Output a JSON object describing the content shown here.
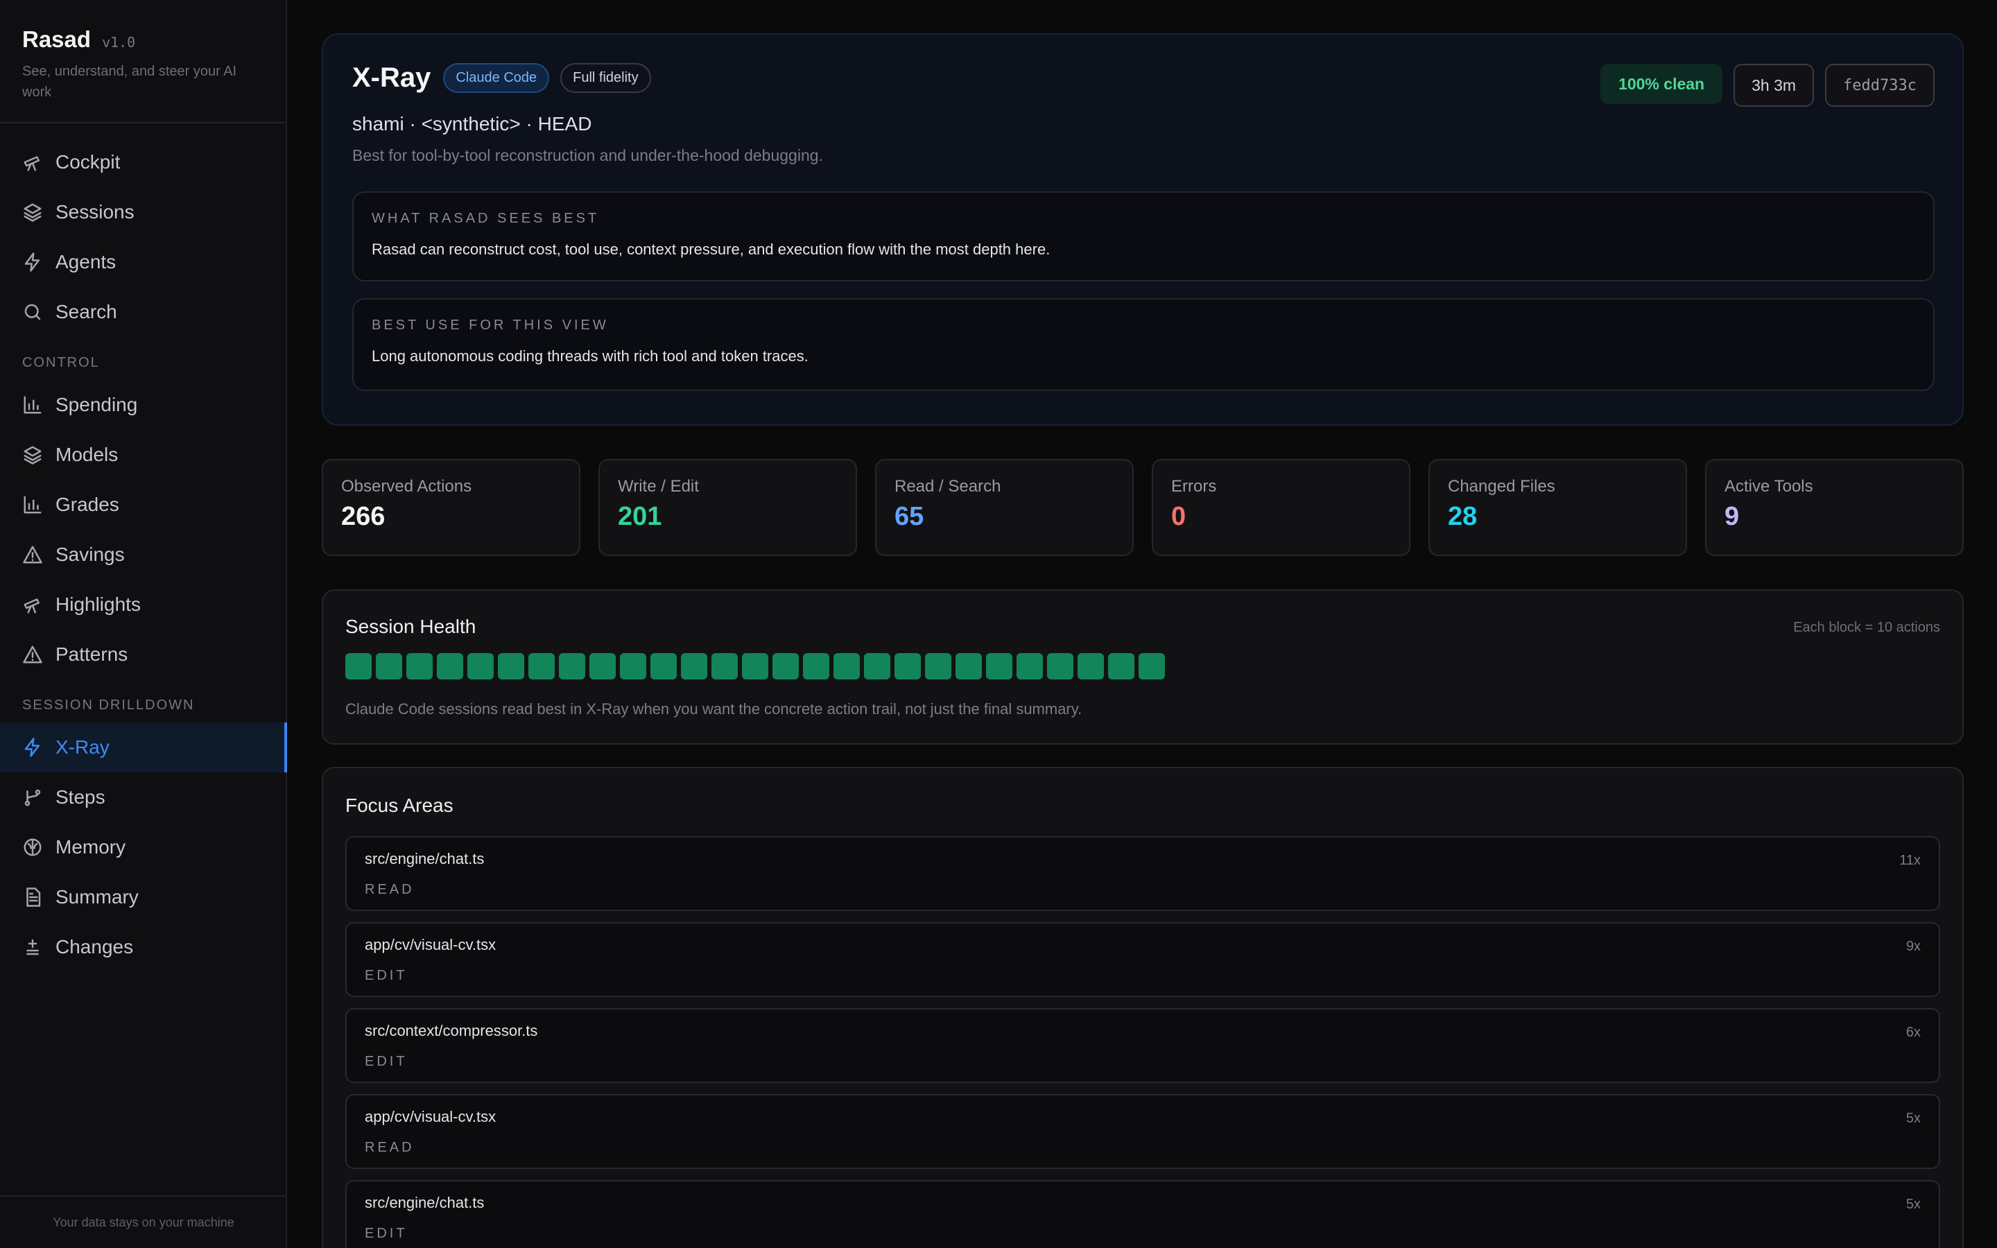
{
  "app": {
    "name": "Rasad",
    "version": "v1.0",
    "tagline": "See, understand, and steer your AI work",
    "footer": "Your data stays on your machine"
  },
  "nav": {
    "main": [
      {
        "label": "Cockpit",
        "icon": "telescope-icon"
      },
      {
        "label": "Sessions",
        "icon": "layers-icon"
      },
      {
        "label": "Agents",
        "icon": "bolt-icon"
      },
      {
        "label": "Search",
        "icon": "search-icon"
      }
    ],
    "control_label": "CONTROL",
    "control": [
      {
        "label": "Spending",
        "icon": "bar-chart-icon"
      },
      {
        "label": "Models",
        "icon": "layers-icon"
      },
      {
        "label": "Grades",
        "icon": "bar-chart-icon"
      },
      {
        "label": "Savings",
        "icon": "warning-icon"
      },
      {
        "label": "Highlights",
        "icon": "telescope-icon"
      },
      {
        "label": "Patterns",
        "icon": "warning-icon"
      }
    ],
    "drilldown_label": "SESSION DRILLDOWN",
    "drilldown": [
      {
        "label": "X-Ray",
        "icon": "bolt-icon",
        "active": true
      },
      {
        "label": "Steps",
        "icon": "git-branch-icon"
      },
      {
        "label": "Memory",
        "icon": "brain-icon"
      },
      {
        "label": "Summary",
        "icon": "document-icon"
      },
      {
        "label": "Changes",
        "icon": "diff-icon"
      }
    ]
  },
  "hero": {
    "title": "X-Ray",
    "pill_agent": "Claude Code",
    "pill_fidelity": "Full fidelity",
    "clean": "100% clean",
    "duration": "3h 3m",
    "commit": "fedd733c",
    "subtitle": "shami · <synthetic> · HEAD",
    "description": "Best for tool-by-tool reconstruction and under-the-hood debugging.",
    "cards": [
      {
        "heading": "WHAT RASAD SEES BEST",
        "body": "Rasad can reconstruct cost, tool use, context pressure, and execution flow with the most depth here."
      },
      {
        "heading": "BEST USE FOR THIS VIEW",
        "body": "Long autonomous coding threads with rich tool and token traces."
      }
    ]
  },
  "stats": [
    {
      "label": "Observed Actions",
      "value": "266",
      "color": "#f4f4f5"
    },
    {
      "label": "Write / Edit",
      "value": "201",
      "color": "#34d399"
    },
    {
      "label": "Read / Search",
      "value": "65",
      "color": "#60a5fa"
    },
    {
      "label": "Errors",
      "value": "0",
      "color": "#f87171"
    },
    {
      "label": "Changed Files",
      "value": "28",
      "color": "#22d3ee"
    },
    {
      "label": "Active Tools",
      "value": "9",
      "color": "#c4b5fd"
    }
  ],
  "health": {
    "title": "Session Health",
    "note": "Each block = 10 actions",
    "blocks": 27,
    "block_color": "#12855a",
    "description": "Claude Code sessions read best in X-Ray when you want the concrete action trail, not just the final summary."
  },
  "focus": {
    "title": "Focus Areas",
    "items": [
      {
        "path": "src/engine/chat.ts",
        "kind": "READ",
        "count": "11x"
      },
      {
        "path": "app/cv/visual-cv.tsx",
        "kind": "EDIT",
        "count": "9x"
      },
      {
        "path": "src/context/compressor.ts",
        "kind": "EDIT",
        "count": "6x"
      },
      {
        "path": "app/cv/visual-cv.tsx",
        "kind": "READ",
        "count": "5x"
      },
      {
        "path": "src/engine/chat.ts",
        "kind": "EDIT",
        "count": "5x"
      }
    ]
  }
}
